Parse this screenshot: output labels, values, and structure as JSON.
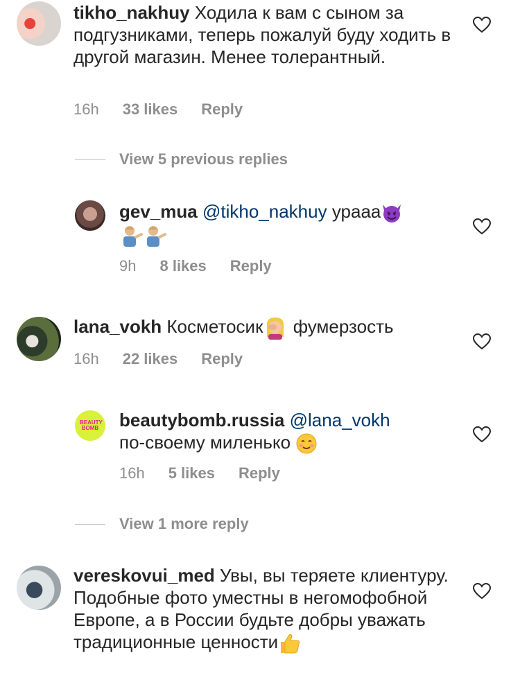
{
  "comments": [
    {
      "username": "tikho_nakhuy",
      "text": "Ходила к вам с сыном за подгузниками, теперь пожалуй буду ходить в другой магазин. Менее толерантный.",
      "time": "16h",
      "likes": "33 likes",
      "reply": "Reply"
    },
    {
      "view_replies": "View 5 previous replies"
    },
    {
      "username": "gev_mua",
      "mention": "@tikho_nakhuy",
      "text": "урааа",
      "time": "9h",
      "likes": "8 likes",
      "reply": "Reply"
    },
    {
      "username": "lana_vokh",
      "text_before": "Косметосик",
      "text_after": "фумерзость",
      "time": "16h",
      "likes": "22 likes",
      "reply": "Reply"
    },
    {
      "username": "beautybomb.russia",
      "mention": "@lana_vokh",
      "text": "по-своему миленько",
      "time": "16h",
      "likes": "5 likes",
      "reply": "Reply",
      "avatar_text": "BEAUTY BOMB"
    },
    {
      "view_replies": "View 1 more reply"
    },
    {
      "username": "vereskovui_med",
      "text": "Увы, вы теряете клиентуру. Подобные фото уместны в негомофобной Европе, а в России будьте добры уважать традиционные ценности",
      "time": "",
      "likes": "",
      "reply": ""
    }
  ],
  "colors": {
    "text": "#262626",
    "meta": "#8e8e8e",
    "mention": "#00376b",
    "avatar_beautybomb": "#d8f23a"
  },
  "icons": {
    "like": "heart-outline-icon",
    "emoji_devil": "smiling-devil-emoji",
    "emoji_shrug": "man-tipping-hand-emoji",
    "emoji_facepalm": "woman-facepalming-emoji",
    "emoji_blush": "smiling-face-emoji",
    "emoji_thumbs": "thumbs-up-emoji"
  }
}
